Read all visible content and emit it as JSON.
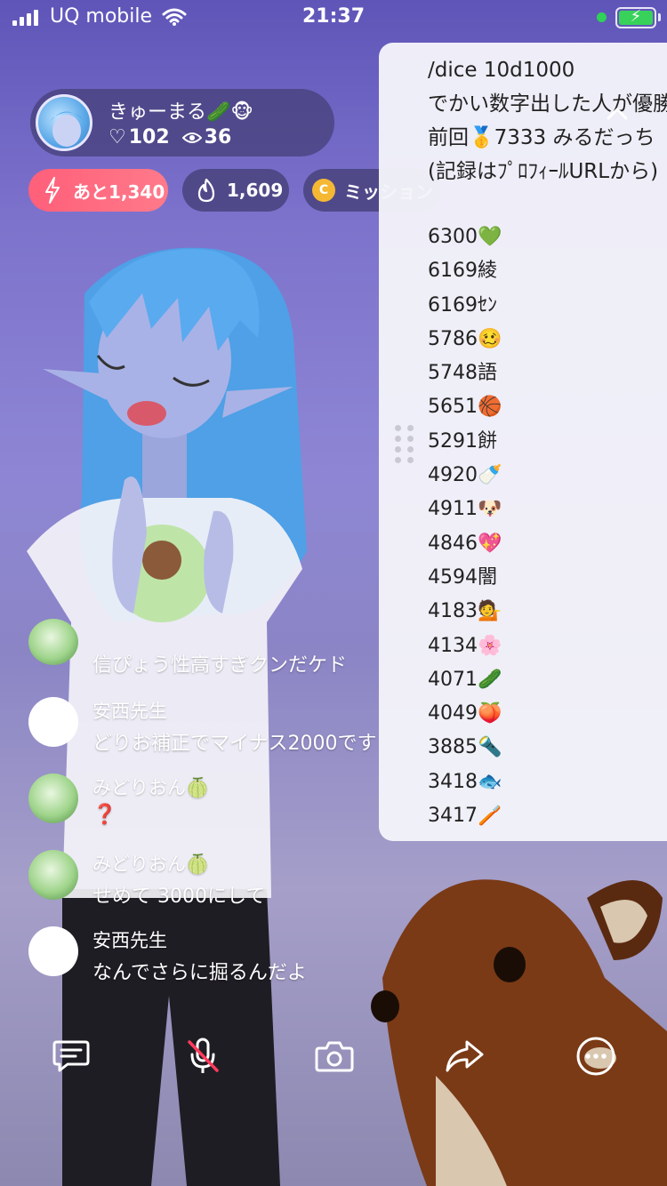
{
  "status": {
    "carrier": "UQ mobile",
    "time": "21:37"
  },
  "host": {
    "name": "きゅーまる🥒🐵",
    "likes": "102",
    "viewers": "36"
  },
  "chips": {
    "gift": "あと1,340",
    "fire": "1,609",
    "mission": "ミッション"
  },
  "panel": {
    "lines": [
      "/dice 10d1000",
      "でかい数字出した人が優勝",
      "前回🥇7333 みるだっち",
      "(記録はﾌﾟﾛﾌｨｰﾙURLから)"
    ],
    "scores": [
      "6300💚",
      "6169綾",
      "6169ｾﾝ",
      "5786🥴",
      "5748語",
      "5651🏀",
      "5291餅",
      "4920🍼",
      "4911🐶",
      "4846💖",
      "4594闇",
      "4183💁",
      "4134🌸",
      "4071🥒",
      "4049🍑",
      "3885🔦",
      "3418🐟",
      "3417🪥"
    ]
  },
  "chat": [
    {
      "name": "",
      "text": "信ぴょう性高すぎクンだケド",
      "avatar": "green"
    },
    {
      "name": "安西先生",
      "text": "どりお補正でマイナス2000です",
      "avatar": "white"
    },
    {
      "name": "みどりおん🍈",
      "text": "❓",
      "avatar": "green"
    },
    {
      "name": "みどりおん🍈",
      "text": "せめて 3000にして",
      "avatar": "green"
    },
    {
      "name": "安西先生",
      "text": "なんでさらに掘るんだよ",
      "avatar": "white"
    }
  ],
  "toolbar": {
    "icons": [
      "comment-icon",
      "mic-muted-icon",
      "camera-icon",
      "share-icon",
      "more-icon"
    ]
  },
  "colors": {
    "accent_gift": "#ff5f7a",
    "battery": "#38d25a",
    "question": "#d92a3a"
  }
}
